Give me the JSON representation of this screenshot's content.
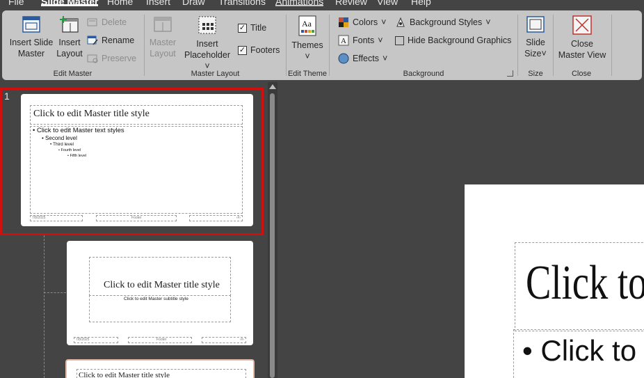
{
  "menu": {
    "tabs": [
      "File",
      "Slide Master",
      "Home",
      "Insert",
      "Draw",
      "Transitions",
      "Animations",
      "Review",
      "View",
      "Help"
    ]
  },
  "ribbon": {
    "edit_master": {
      "label": "Edit Master",
      "insert_slide_master_line1": "Insert Slide",
      "insert_slide_master_line2": "Master",
      "insert_layout_line1": "Insert",
      "insert_layout_line2": "Layout",
      "delete": "Delete",
      "rename": "Rename",
      "preserve": "Preserve"
    },
    "master_layout": {
      "label": "Master Layout",
      "master_layout_line1": "Master",
      "master_layout_line2": "Layout",
      "insert_placeholder_line1": "Insert",
      "insert_placeholder_line2": "Placeholder",
      "title": "Title",
      "footers": "Footers",
      "title_checked": true,
      "footers_checked": true
    },
    "edit_theme": {
      "label": "Edit Theme",
      "themes": "Themes"
    },
    "background": {
      "label": "Background",
      "colors": "Colors",
      "fonts": "Fonts",
      "effects": "Effects",
      "background_styles": "Background Styles",
      "hide_background_graphics": "Hide Background Graphics",
      "hide_checked": false
    },
    "size": {
      "label": "Size",
      "slide_size_line1": "Slide",
      "slide_size_line2": "Size"
    },
    "close": {
      "label": "Close",
      "close_line1": "Close",
      "close_line2": "Master View"
    }
  },
  "thumbnails": {
    "slide_number": "1",
    "master": {
      "title": "Click to edit Master title style",
      "body_l1": "• Click to edit Master text styles",
      "body_l2": "Second level",
      "body_l3": "Third level",
      "body_l4": "Fourth level",
      "body_l5": "Fifth level",
      "footer_date": "7/8/2025",
      "footer_center": "Footer",
      "footer_num": "‹#›"
    },
    "layout1": {
      "title": "Click to edit Master title style",
      "subtitle": "Click to edit Master subtitle style",
      "footer_date": "7/8/2025",
      "footer_center": "Footer",
      "footer_num": "‹#›"
    },
    "layout2": {
      "title": "Click to edit Master title style"
    }
  },
  "canvas": {
    "title_fragment": "Click to",
    "body_fragment": "• Click to"
  },
  "colors": {
    "ribbon_bg": "#c6c6c6",
    "app_bg": "#444444",
    "selection": "#d00f0f",
    "layout2_border": "#e3b9a7"
  }
}
